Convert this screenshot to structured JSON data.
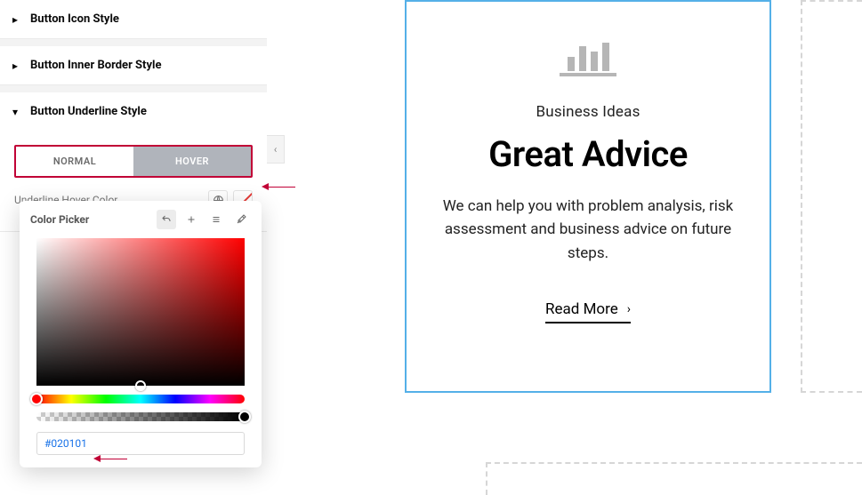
{
  "sidebar": {
    "sections": {
      "icon": {
        "label": "Button Icon Style"
      },
      "innerBorder": {
        "label": "Button Inner Border Style"
      },
      "underline": {
        "label": "Button Underline Style"
      }
    },
    "tabs": {
      "normal": "NORMAL",
      "hover": "HOVER"
    },
    "control": {
      "label": "Underline Hover Color"
    }
  },
  "picker": {
    "title": "Color Picker",
    "hex": "#020101"
  },
  "card": {
    "eyebrow": "Business Ideas",
    "title": "Great Advice",
    "desc": "We can help you with problem analysis, risk assessment and business advice on future steps.",
    "readmore": "Read More"
  }
}
